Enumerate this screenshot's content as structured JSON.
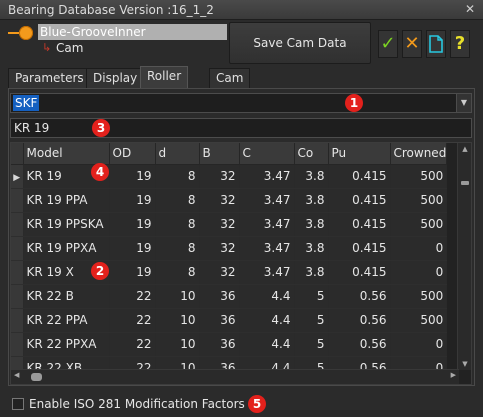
{
  "window": {
    "title": "Bearing Database Version :16_1_2",
    "close_label": "✕"
  },
  "tree": {
    "selected_label": "Blue-GrooveInner",
    "child_label": "Cam"
  },
  "toolbar": {
    "save_label": "Save Cam Data",
    "ok_symbol": "✓",
    "cancel_symbol": "✕",
    "new_symbol": "🗋",
    "help_symbol": "?"
  },
  "tabs": [
    {
      "label": "Parameters",
      "active": false
    },
    {
      "label": "Display",
      "active": false
    },
    {
      "label": "Roller Life",
      "active": true
    },
    {
      "label": "Cam Life",
      "active": false
    }
  ],
  "manufacturer": {
    "selected": "SKF"
  },
  "search": {
    "value": "KR 19"
  },
  "table": {
    "columns": [
      "Model",
      "OD",
      "d",
      "B",
      "C",
      "Co",
      "Pu",
      "Crowned"
    ],
    "rows": [
      [
        "KR 19",
        "19",
        "8",
        "32",
        "3.47",
        "3.8",
        "0.415",
        "500"
      ],
      [
        "KR 19 PPA",
        "19",
        "8",
        "32",
        "3.47",
        "3.8",
        "0.415",
        "500"
      ],
      [
        "KR 19 PPSKA",
        "19",
        "8",
        "32",
        "3.47",
        "3.8",
        "0.415",
        "500"
      ],
      [
        "KR 19 PPXA",
        "19",
        "8",
        "32",
        "3.47",
        "3.8",
        "0.415",
        "0"
      ],
      [
        "KR 19 X",
        "19",
        "8",
        "32",
        "3.47",
        "3.8",
        "0.415",
        "0"
      ],
      [
        "KR 22 B",
        "22",
        "10",
        "36",
        "4.4",
        "5",
        "0.56",
        "500"
      ],
      [
        "KR 22 PPA",
        "22",
        "10",
        "36",
        "4.4",
        "5",
        "0.56",
        "500"
      ],
      [
        "KR 22 PPXA",
        "22",
        "10",
        "36",
        "4.4",
        "5",
        "0.56",
        "0"
      ],
      [
        "KR 22 XB",
        "22",
        "10",
        "36",
        "4.4",
        "5",
        "0.56",
        "0"
      ]
    ]
  },
  "options": {
    "iso_label": "Enable ISO 281 Modification Factors"
  },
  "badges": [
    "1",
    "2",
    "3",
    "4",
    "5"
  ],
  "colors": {
    "badge": "#e3211c",
    "selection": "#1560c0",
    "tree_node": "#f39a1c"
  }
}
